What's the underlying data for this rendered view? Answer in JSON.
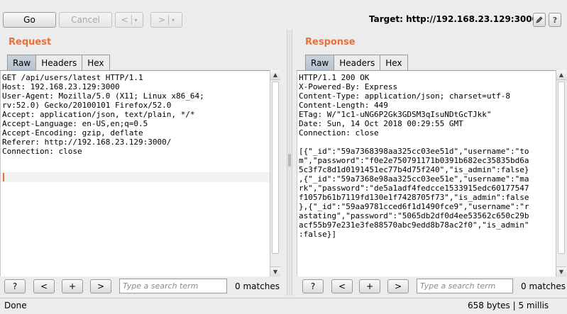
{
  "toolbar": {
    "go_label": "Go",
    "cancel_label": "Cancel",
    "back_label": "<",
    "forward_label": ">",
    "dropdown_glyph": "▾",
    "target_label": "Target: http://192.168.23.129:3000",
    "edit_icon": "pencil-icon",
    "help_icon": "question-icon"
  },
  "request": {
    "title": "Request",
    "tabs": [
      "Raw",
      "Headers",
      "Hex"
    ],
    "active_tab": "Raw",
    "content": "GET /api/users/latest HTTP/1.1\nHost: 192.168.23.129:3000\nUser-Agent: Mozilla/5.0 (X11; Linux x86_64;\nrv:52.0) Gecko/20100101 Firefox/52.0\nAccept: application/json, text/plain, */*\nAccept-Language: en-US,en;q=0.5\nAccept-Encoding: gzip, deflate\nReferer: http://192.168.23.129:3000/\nConnection: close",
    "search": {
      "help_label": "?",
      "prev_label": "<",
      "add_label": "+",
      "next_label": ">",
      "placeholder": "Type a search term",
      "matches": "0 matches"
    }
  },
  "response": {
    "title": "Response",
    "tabs": [
      "Raw",
      "Headers",
      "Hex"
    ],
    "active_tab": "Raw",
    "content": "HTTP/1.1 200 OK\nX-Powered-By: Express\nContent-Type: application/json; charset=utf-8\nContent-Length: 449\nETag: W/\"1c1-uNG6P2Gk3GDSM3qIsuNDtGcTJkk\"\nDate: Sun, 14 Oct 2018 00:29:55 GMT\nConnection: close\n\n[{\"_id\":\"59a7368398aa325cc03ee51d\",\"username\":\"to\nm\",\"password\":\"f0e2e750791171b0391b682ec35835bd6a\n5c3f7c8d1d0191451ec77b4d75f240\",\"is_admin\":false}\n,{\"_id\":\"59a7368e98aa325cc03ee51e\",\"username\":\"ma\nrk\",\"password\":\"de5a1adf4fedcce1533915edc60177547\nf1057b61b7119fd130e1f7428705f73\",\"is_admin\":false\n},{\"_id\":\"59aa9781cced6f1d1490fce9\",\"username\":\"r\nastating\",\"password\":\"5065db2df0d4ee53562c650c29b\nacf55b97e231e3fe88570abc9edd8b78ac2f0\",\"is_admin\"\n:false}]",
    "search": {
      "help_label": "?",
      "prev_label": "<",
      "add_label": "+",
      "next_label": ">",
      "placeholder": "Type a search term",
      "matches": "0 matches"
    }
  },
  "status": {
    "left": "Done",
    "right": "658 bytes | 5 millis"
  },
  "colors": {
    "accent": "#e8703a",
    "active_tab": "#bcc8d4"
  }
}
